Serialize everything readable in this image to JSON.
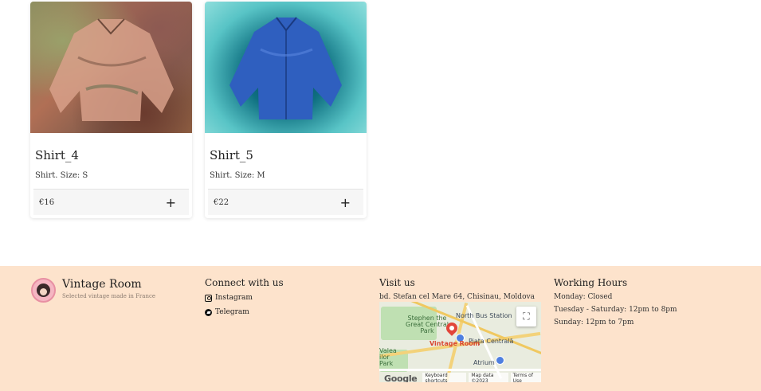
{
  "products": [
    {
      "title": "Shirt_4",
      "subtitle": "Shirt. Size: S",
      "price": "€16",
      "add_icon": "+"
    },
    {
      "title": "Shirt_5",
      "subtitle": "Shirt. Size: M",
      "price": "€22",
      "add_icon": "+"
    }
  ],
  "footer": {
    "brand": {
      "name": "Vintage Room",
      "tagline": "Selected vintage made in France"
    },
    "connect": {
      "heading": "Connect with us",
      "links": [
        {
          "label": "Instagram",
          "icon": "instagram-icon"
        },
        {
          "label": "Telegram",
          "icon": "telegram-icon"
        }
      ]
    },
    "visit": {
      "heading": "Visit us",
      "address": "bd. Stefan cel Mare 64, Chisinau, Moldova",
      "map": {
        "labels": [
          "Stephen the Great Central Park",
          "North Bus Station",
          "Piața Centrală",
          "Valea ilor Park",
          "Atrium"
        ],
        "pin_label": "Vintage Room",
        "fullscreen_icon": "⛶",
        "google": "Google",
        "keyboard": "Keyboard shortcuts",
        "mapdata": "Map data ©2023",
        "terms": "Terms of Use"
      }
    },
    "hours": {
      "heading": "Working Hours",
      "lines": [
        "Monday: Closed",
        "Tuesday - Saturday: 12pm to 8pm",
        "Sunday: 12pm to 7pm"
      ]
    }
  },
  "colors": {
    "footer_bg": "#fde3cc",
    "card_foot_bg": "#f6f6f6",
    "pin": "#e2453a"
  }
}
